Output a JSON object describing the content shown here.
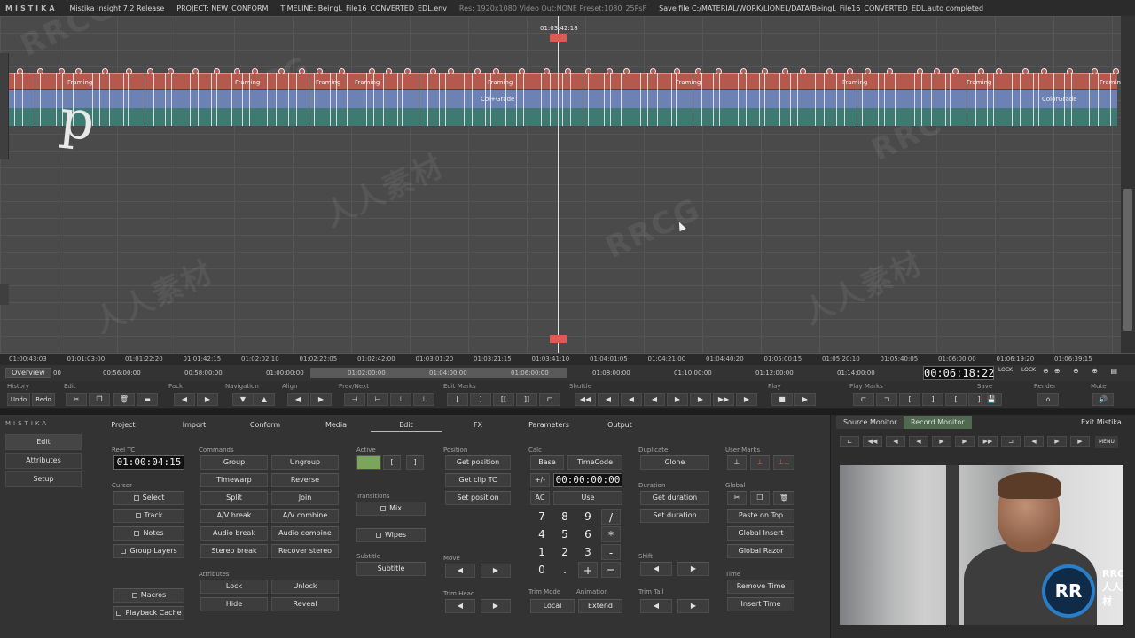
{
  "titlebar": {
    "brand": "MISTIKA",
    "app": "Mistika Insight 7.2 Release",
    "project": "PROJECT: NEW_CONFORM",
    "timeline": "TIMELINE: BeingL_File16_CONVERTED_EDL.env",
    "res": "Res: 1920x1080 Video Out:NONE Preset:1080_25PsF",
    "status": "Save file C:/MATERIAL/WORK/LIONEL/DATA/BeingL_File16_CONVERTED_EDL.auto completed"
  },
  "watermark": {
    "brand": "RRCG",
    "cn": "人人素材"
  },
  "timeline": {
    "playhead_tc": "01:03:42:18",
    "clip_framing": "Framing",
    "clip_colgrade": "Col+Grade",
    "clip_colorgrade": "ColorGrade",
    "cursor_glyph": "p"
  },
  "ruler": [
    "01:00:43:03",
    "01:01:03:00",
    "01:01:22:20",
    "01:01:42:15",
    "01:02:02:10",
    "01:02:22:05",
    "01:02:42:00",
    "01:03:01:20",
    "01:03:21:15",
    "01:03:41:10",
    "01:04:01:05",
    "01:04:21:00",
    "01:04:40:20",
    "01:05:00:15",
    "01:05:20:10",
    "01:05:40:05",
    "01:06:00:00",
    "01:06:19:20",
    "01:06:39:15"
  ],
  "overview": {
    "label": "Overview",
    "small": "00",
    "ticks": [
      "00:56:00:00",
      "00:58:00:00",
      "01:00:00:00",
      "01:02:00:00",
      "01:04:00:00",
      "01:06:00:00",
      "01:08:00:00",
      "01:10:00:00",
      "01:12:00:00",
      "01:14:00:00"
    ],
    "bigtc": "00:06:18:22",
    "lock1": "LOCK",
    "lock2": "LOCK"
  },
  "toolbar": {
    "groups": [
      "History",
      "Edit",
      "Pack",
      "Navigation",
      "Align",
      "Prev/Next",
      "Edit Marks",
      "Shuttle",
      "Play",
      "Play Marks",
      "Save",
      "Render",
      "Mute"
    ],
    "undo": "Undo",
    "redo": "Redo"
  },
  "bottom": {
    "brand": "MISTIKA",
    "tabs": [
      "Project",
      "Import",
      "Conform",
      "Media",
      "Edit",
      "FX",
      "Parameters",
      "Output"
    ],
    "sidenav": [
      "Edit",
      "Attributes",
      "Setup"
    ],
    "reel_label": "Reel TC",
    "reel_tc": "01:00:04:15",
    "cursor_label": "Cursor",
    "cursor_items": [
      "Select",
      "Track",
      "Notes",
      "Group Layers"
    ],
    "macros": "Macros",
    "playback_cache": "Playback Cache",
    "commands_label": "Commands",
    "commands": [
      [
        "Group",
        "Ungroup"
      ],
      [
        "Timewarp",
        "Reverse"
      ],
      [
        "Split",
        "Join"
      ],
      [
        "A/V break",
        "A/V combine"
      ],
      [
        "Audio break",
        "Audio combine"
      ],
      [
        "Stereo break",
        "Recover stereo"
      ]
    ],
    "attributes_label": "Attributes",
    "attributes": [
      [
        "Lock",
        "Unlock"
      ],
      [
        "Hide",
        "Reveal"
      ]
    ],
    "active_label": "Active",
    "transitions_label": "Transitions",
    "mix": "Mix",
    "wipes": "Wipes",
    "subtitle_label": "Subtitle",
    "subtitle": "Subtitle",
    "position_label": "Position",
    "position": [
      "Get position",
      "Get clip TC",
      "Set position"
    ],
    "move_label": "Move",
    "trim_head_label": "Trim Head",
    "calc_label": "Calc",
    "base": "Base",
    "timecode": "TimeCode",
    "calc_field": "00:00:00:00",
    "plusminus": "+/-",
    "ac": "AC",
    "use": "Use",
    "keys": [
      [
        "7",
        "8",
        "9",
        "/"
      ],
      [
        "4",
        "5",
        "6",
        "*"
      ],
      [
        "1",
        "2",
        "3",
        "-"
      ],
      [
        "0",
        ".",
        "+",
        "="
      ]
    ],
    "trim_mode_label": "Trim Mode",
    "animation_label": "Animation",
    "local": "Local",
    "extend": "Extend",
    "duplicate_label": "Duplicate",
    "clone": "Clone",
    "duration_label": "Duration",
    "get_duration": "Get duration",
    "set_duration": "Set duration",
    "shift_label": "Shift",
    "trim_tail_label": "Trim Tail",
    "user_marks_label": "User Marks",
    "global_label": "Global",
    "global": [
      "Paste on Top",
      "Global Insert",
      "Global Razor"
    ],
    "time_label": "Time",
    "time": [
      "Remove Time",
      "Insert Time"
    ]
  },
  "monitor": {
    "tabs": [
      "Source Monitor",
      "Record Monitor"
    ],
    "exit": "Exit Mistika",
    "menu": "MENU",
    "logo": "RR",
    "wm_brand": "RRCG",
    "wm_cn": "人人素材"
  }
}
